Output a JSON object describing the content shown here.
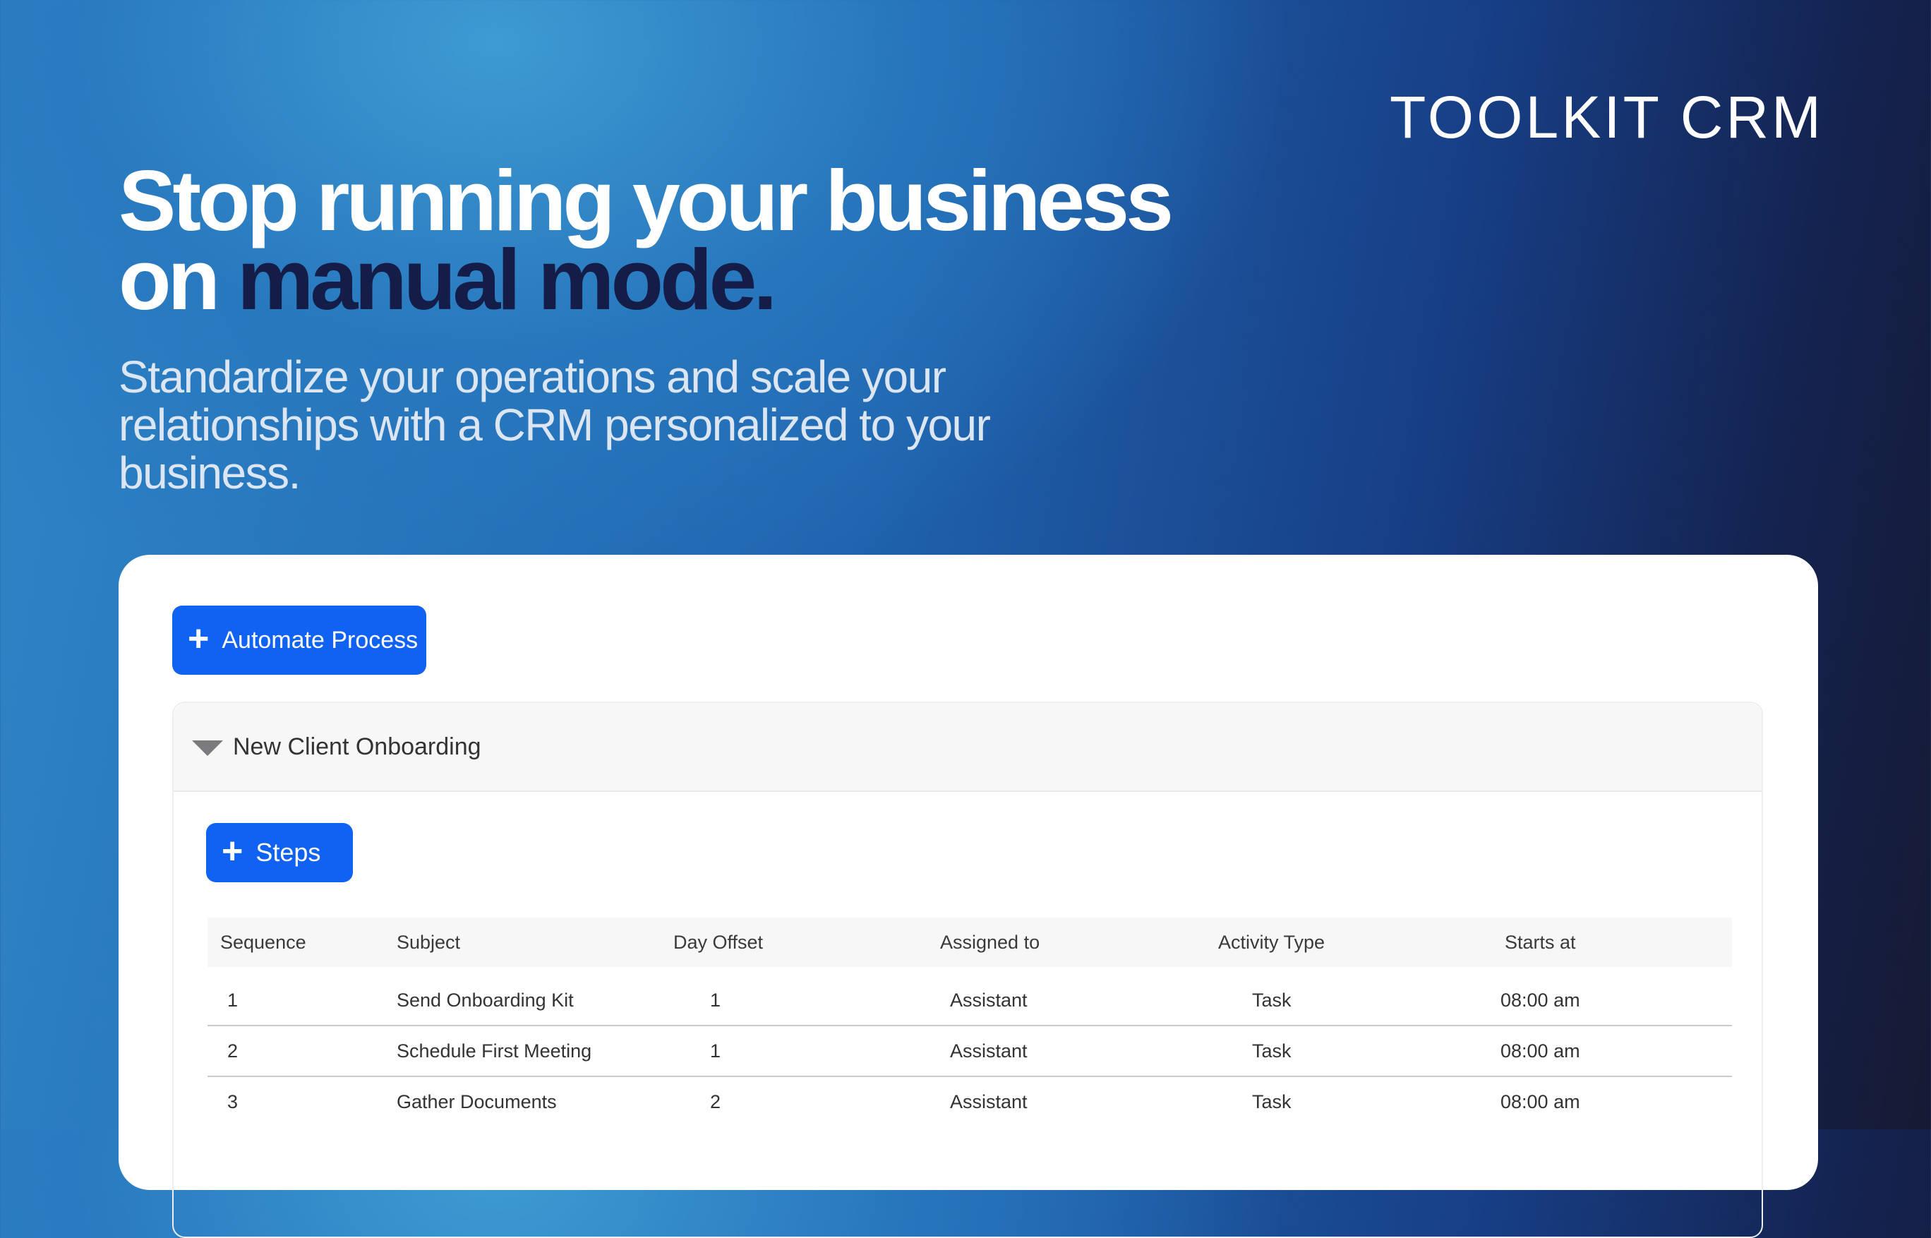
{
  "brand": "TOOLKIT CRM",
  "headline": {
    "line1": "Stop running your business",
    "line2_prefix": "on ",
    "line2_accent": "manual mode."
  },
  "subheadline": "Standardize your operations and scale your relationships with a CRM personalized to your business.",
  "toolbar": {
    "automate_label": "Automate Process"
  },
  "process": {
    "title": "New Client Onboarding",
    "steps_label": "Steps",
    "columns": [
      "Sequence",
      "Subject",
      "Day Offset",
      "Assigned to",
      "Activity Type",
      "Starts at"
    ],
    "rows": [
      [
        "1",
        "Send Onboarding Kit",
        "1",
        "Assistant",
        "Task",
        "08:00 am"
      ],
      [
        "2",
        "Schedule First Meeting",
        "1",
        "Assistant",
        "Task",
        "08:00 am"
      ],
      [
        "3",
        "Gather Documents",
        "2",
        "Assistant",
        "Task",
        "08:00 am"
      ]
    ]
  },
  "colors": {
    "accent": "#0f62f2",
    "headline_accent": "#131d48"
  }
}
